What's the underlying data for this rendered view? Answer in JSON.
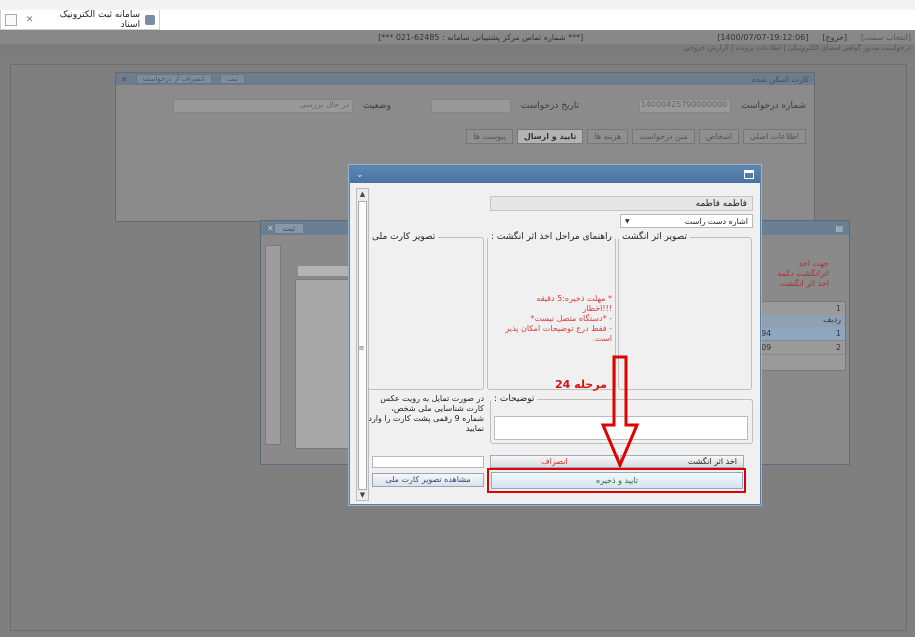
{
  "browser": {
    "tab_title": "سامانه ثبت الکترونیک اسناد"
  },
  "appbar": {
    "datetime": "[1400/07/07-19:12:06]",
    "exit": "[خروج]",
    "user": "[انتخاب سمت]",
    "support": "[*** شماره تماس مرکز پشتیبانی سامانه : 62485-021 ***]",
    "breadcrumb": "درخواست صدور گواهی امضای الکترونیکی | اطلاعات پرونده | گزارش خروجی"
  },
  "form_panel": {
    "title": "کارت اسکن شده",
    "btn_register": "ثبت",
    "btn_cancel_request": "انصراف از درخواست",
    "request_no_label": "شماره درخواست",
    "request_no_value": "14000425790000000",
    "request_date_label": "تاریخ درخواست",
    "status_label": "وضعیت",
    "status_value": "در حال بررسی",
    "tabs": [
      "اطلاعات اصلی",
      "اشخاص",
      "متن درخواست",
      "هزینه ها",
      "تایید و ارسال",
      "پیوست ها"
    ],
    "active_tab": "تایید و ارسال"
  },
  "bg_dialog": {
    "btn_register": "ثبت",
    "hint": "جهت اخذ اثرانگشت دکمه اخذ اثر انگشت",
    "page_value": "1",
    "grid_header": "ردیف",
    "rows": [
      {
        "num": "1",
        "val": "994"
      },
      {
        "num": "2",
        "val": "609"
      }
    ]
  },
  "modal": {
    "person_name": "فاطمه فاطمه",
    "finger_select": "اشاره دست راست",
    "group_fingerprint": "تصویر اثر انگشت",
    "group_guide": "راهنمای مراحل اخذ اثر انگشت :",
    "group_idcard": "تصویر کارت ملی",
    "guide_lines": [
      "* مهلت ذخیره:5 دقیقه",
      "!!!اخطار",
      "- *دستگاه متصل نیست*",
      "- فقط درج توضیحات امکان پذیر",
      "است."
    ],
    "desc_label": "توضیحات :",
    "id_hint": "در صورت تمایل به رویت عکس کارت شناسایی ملی شخص، شماره 9 رقمی پشت کارت را وارد نمایید",
    "btn_capture": "اخذ اثر انگشت",
    "btn_cancel": "انصراف",
    "btn_view_card": "مشاهده تصویر کارت ملی",
    "btn_confirm": "تایید و ذخیره"
  },
  "annotation": {
    "step_label": "مرحله 24",
    "color": "#e00000"
  }
}
